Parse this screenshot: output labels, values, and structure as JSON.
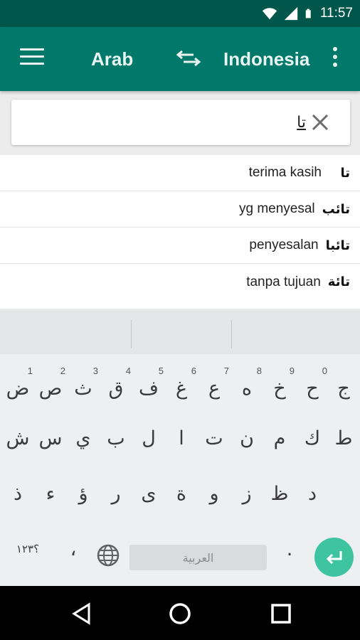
{
  "status_bar": {
    "time": "11:57",
    "icons": [
      "wifi-icon",
      "signal-icon",
      "battery-icon"
    ]
  },
  "app_bar": {
    "source_language": "Arab",
    "target_language": "Indonesia",
    "icons": [
      "menu-icon",
      "swap-languages-icon",
      "more-vert-icon"
    ]
  },
  "search": {
    "value": "تا",
    "clear_icon": "close-icon"
  },
  "suggestions": [
    {
      "word": "تا",
      "meaning": "terima kasih"
    },
    {
      "word": "تائب",
      "meaning": "yg menyesal"
    },
    {
      "word": "تائبا",
      "meaning": "penyesalan"
    },
    {
      "word": "تائة",
      "meaning": "tanpa tujuan"
    }
  ],
  "keyboard": {
    "row1": [
      {
        "char": "ض",
        "hint": "1"
      },
      {
        "char": "ص",
        "hint": "2"
      },
      {
        "char": "ث",
        "hint": "3"
      },
      {
        "char": "ق",
        "hint": "4"
      },
      {
        "char": "ف",
        "hint": "5"
      },
      {
        "char": "غ",
        "hint": "6"
      },
      {
        "char": "ع",
        "hint": "7"
      },
      {
        "char": "ه",
        "hint": "8"
      },
      {
        "char": "خ",
        "hint": "9"
      },
      {
        "char": "ح",
        "hint": "0"
      },
      {
        "char": "ج",
        "hint": ""
      }
    ],
    "row2": [
      "ش",
      "س",
      "ي",
      "ب",
      "ل",
      "ا",
      "ت",
      "ن",
      "م",
      "ك",
      "ط"
    ],
    "row3": [
      "ذ",
      "ء",
      "ؤ",
      "ر",
      "ى",
      "ة",
      "و",
      "ز",
      "ظ",
      "د"
    ],
    "row4": {
      "numbers_key": "؟١٢٣",
      "comma_key": "،",
      "space_label": "العربية",
      "period_key": "."
    },
    "accent_color": "#3ec4a1"
  },
  "nav_bar": {
    "icons": [
      "back-icon",
      "home-icon",
      "recents-icon"
    ]
  },
  "colors": {
    "primary": "#00796b",
    "primary_dark": "#00564b"
  }
}
